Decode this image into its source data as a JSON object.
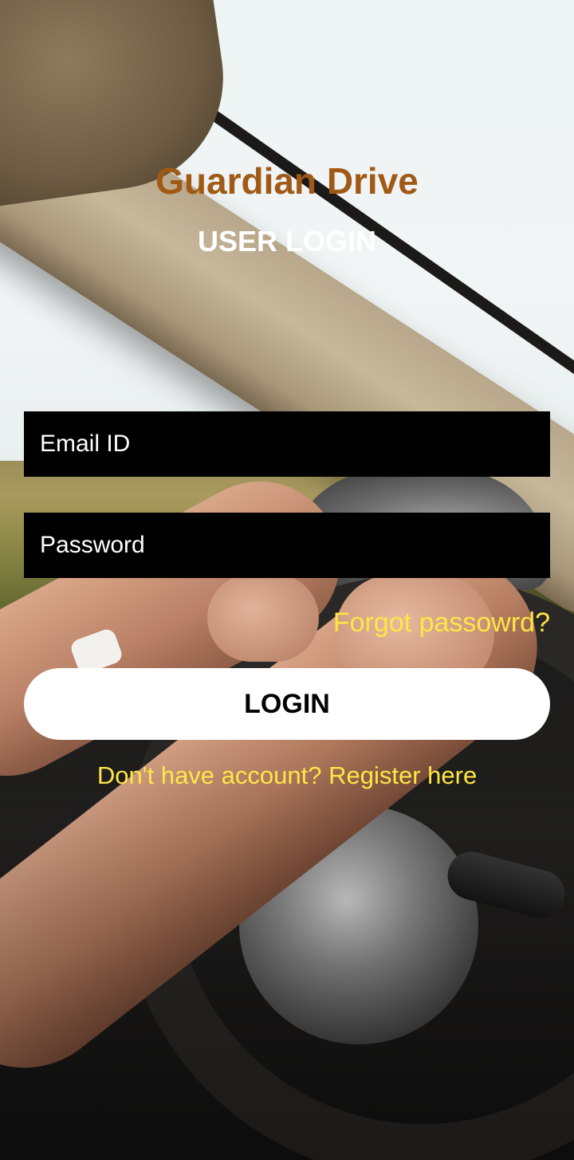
{
  "app": {
    "title": "Guardian Drive",
    "subtitle": "USER LOGIN"
  },
  "form": {
    "email_placeholder": "Email ID",
    "email_value": "",
    "password_placeholder": "Password",
    "password_value": "",
    "forgot_label": "Forgot passowrd?",
    "login_label": "LOGIN",
    "register_label": "Don't have account? Register here"
  },
  "colors": {
    "title": "#a05a16",
    "subtitle": "#ffffff",
    "link": "#ffe645",
    "input_background": "#000000",
    "input_text": "#ffffff",
    "button_background": "#ffffff",
    "button_text": "#000000"
  },
  "background": {
    "description_icon": "car-interior-driving-photo"
  }
}
